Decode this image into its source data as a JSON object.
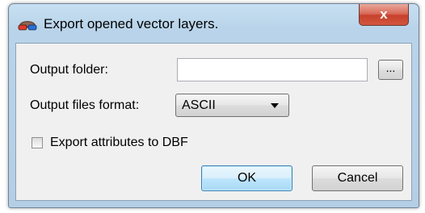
{
  "window": {
    "title": "Export opened vector layers.",
    "close_label": "x"
  },
  "form": {
    "output_folder_label": "Output folder:",
    "output_folder_value": "",
    "browse_label": "...",
    "format_label": "Output files format:",
    "format_selected": "ASCII",
    "export_dbf_label": "Export attributes to DBF",
    "export_dbf_checked": false
  },
  "buttons": {
    "ok_label": "OK",
    "cancel_label": "Cancel"
  },
  "icons": {
    "app": "3d-glasses-icon",
    "close": "close-icon",
    "dropdown": "chevron-down-icon"
  },
  "colors": {
    "title_bar": "#b9d4ea",
    "close_button": "#c7412c",
    "default_button_border": "#3c7fb1"
  }
}
